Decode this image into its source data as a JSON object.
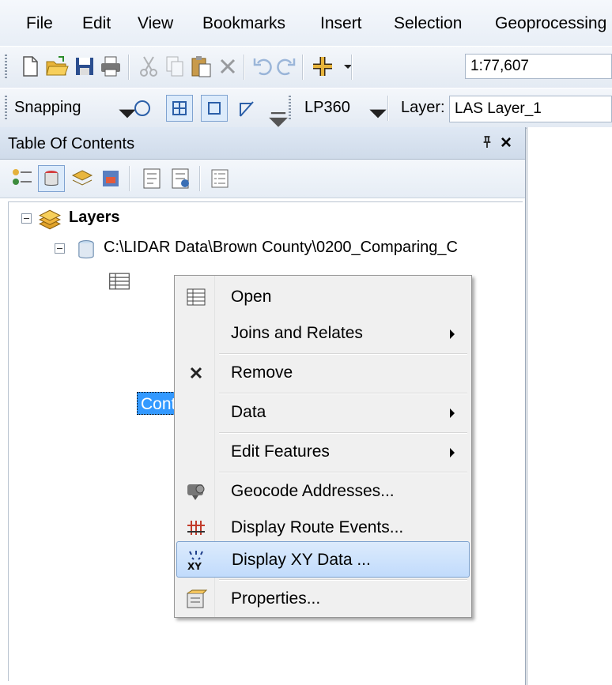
{
  "menubar": {
    "items": [
      "File",
      "Edit",
      "View",
      "Bookmarks",
      "Insert",
      "Selection",
      "Geoprocessing"
    ]
  },
  "toolbar1": {
    "scale": "1:77,607"
  },
  "toolbar2": {
    "snapping_label": "Snapping",
    "lp360_label": "LP360",
    "layer_label": "Layer:",
    "layer_value": "LAS Layer_1"
  },
  "toc": {
    "title": "Table Of Contents",
    "pin_glyph": "p",
    "close_glyph": "×",
    "root_label": "Layers",
    "workspace_label": "C:\\LIDAR Data\\Brown County\\0200_Comparing_C",
    "selected_label": "Control_Points.txt"
  },
  "context_menu": {
    "items": [
      {
        "label": "Open",
        "icon": "table-icon",
        "submenu": false
      },
      {
        "label": "Joins and Relates",
        "icon": "",
        "submenu": true
      },
      {
        "label": "Remove",
        "icon": "remove-x-icon",
        "submenu": false
      },
      {
        "label": "Data",
        "icon": "",
        "submenu": true
      },
      {
        "label": "Edit Features",
        "icon": "",
        "submenu": true
      },
      {
        "label": "Geocode Addresses...",
        "icon": "geocode-icon",
        "submenu": false
      },
      {
        "label": "Display Route Events...",
        "icon": "route-events-icon",
        "submenu": false
      },
      {
        "label": "Display XY Data ...",
        "icon": "xy-data-icon",
        "submenu": false,
        "highlighted": true
      },
      {
        "label": "Properties...",
        "icon": "properties-icon",
        "submenu": false
      }
    ]
  },
  "colors": {
    "selection": "#3399ff",
    "menu_highlight": "#c1dbfc",
    "folder": "#f0b43c"
  }
}
